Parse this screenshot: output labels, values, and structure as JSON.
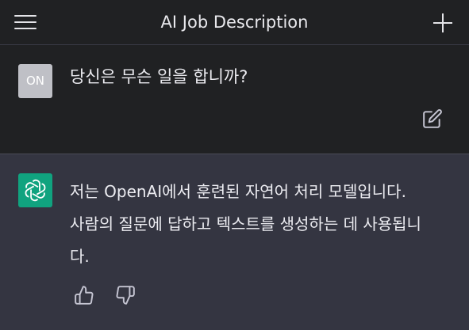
{
  "header": {
    "title": "AI Job Description",
    "menu_icon": "hamburger-menu-icon",
    "new_chat_icon": "plus-icon"
  },
  "user_message": {
    "avatar_initials": "ON",
    "text": "당신은 무슨 일을 합니까?",
    "edit_icon": "edit-icon"
  },
  "assistant_message": {
    "avatar_icon": "openai-logo-icon",
    "lines": [
      "저는 OpenAI에서 훈련된 자연어 처리 모델입니다.",
      "사람의 질문에 답하고 텍스트를 생성하는 데 사용됩니",
      "다."
    ],
    "thumbs_up_icon": "thumbs-up-icon",
    "thumbs_down_icon": "thumbs-down-icon"
  },
  "colors": {
    "header_bg": "#202123",
    "user_bg": "#202123",
    "assistant_bg": "#343541",
    "user_avatar": "#bfc0c6",
    "assistant_avatar": "#10a37f",
    "text": "#ececf1"
  }
}
